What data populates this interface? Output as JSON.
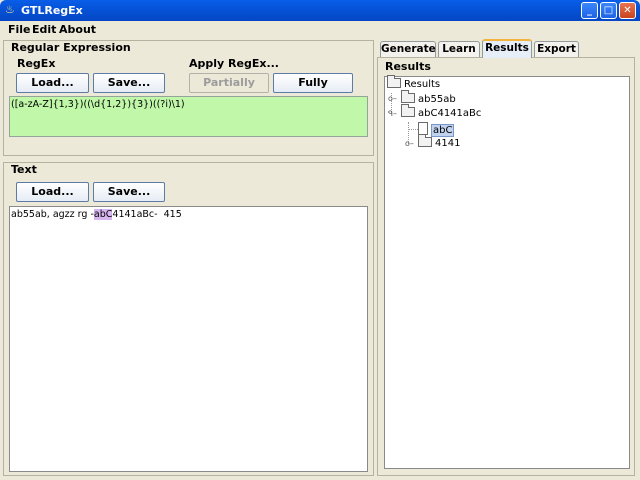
{
  "window": {
    "title": "GTLRegEx",
    "app_icon": "coffee-cup-icon",
    "minimize_glyph": "_",
    "maximize_glyph": "□",
    "close_glyph": "✕"
  },
  "menu": {
    "file": "File",
    "edit": "Edit",
    "about": "About"
  },
  "regex_panel": {
    "title": "Regular Expression",
    "regex_label": "RegEx",
    "apply_label": "Apply RegEx...",
    "load_button": "Load...",
    "save_button": "Save...",
    "partially_button": "Partially",
    "fully_button": "Fully",
    "expression": "([a-zA-Z]{1,3})((\\d{1,2}){3})((?i)\\1)",
    "box_color": "#c0f7a9"
  },
  "text_panel": {
    "title": "Text",
    "load_button": "Load...",
    "save_button": "Save...",
    "text_before": "ab55ab, agzz rg -",
    "text_highlight": "abC",
    "text_after": "4141aBc-  415",
    "highlight_color": "#d7b6ef"
  },
  "tabs": [
    {
      "label": "Generate",
      "active": false
    },
    {
      "label": "Learn",
      "active": false
    },
    {
      "label": "Results",
      "active": true
    },
    {
      "label": "Export",
      "active": false
    }
  ],
  "results": {
    "group_title": "Results",
    "root": "Results",
    "child1": "ab55ab",
    "child2": "abC4141aBc",
    "leaf_selected": "abC",
    "child3": "4141"
  }
}
